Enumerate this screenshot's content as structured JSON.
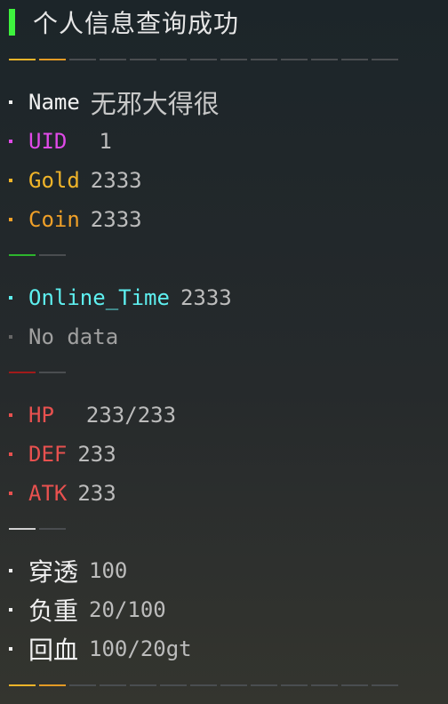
{
  "title": "个人信息查询成功",
  "colors": {
    "title_bar": "#3ef33e",
    "white": "#f0f0f0",
    "magenta": "#e04ae8",
    "gold": "#f0b429",
    "cyan": "#5ef0f0",
    "gray": "#8a8a8a",
    "red": "#e8514f",
    "green": "#2db52d",
    "dark_red": "#a11a1a",
    "light_gray": "#d0d0d0"
  },
  "basic": {
    "name_key": "Name",
    "name_value": "无邪大得很",
    "uid_key": "UID",
    "uid_value": "1",
    "gold_key": "Gold",
    "gold_value": "2333",
    "coin_key": "Coin",
    "coin_value": "2333"
  },
  "online": {
    "key": "Online_Time",
    "value": "2333",
    "note": "No data"
  },
  "combat": {
    "hp_key": "HP",
    "hp_value": "233/233",
    "def_key": "DEF",
    "def_value": "233",
    "atk_key": "ATK",
    "atk_value": "233"
  },
  "extra": {
    "pierce_key": "穿透",
    "pierce_value": "100",
    "load_key": "负重",
    "load_value": "20/100",
    "regen_key": "回血",
    "regen_value": "100/20gt"
  }
}
